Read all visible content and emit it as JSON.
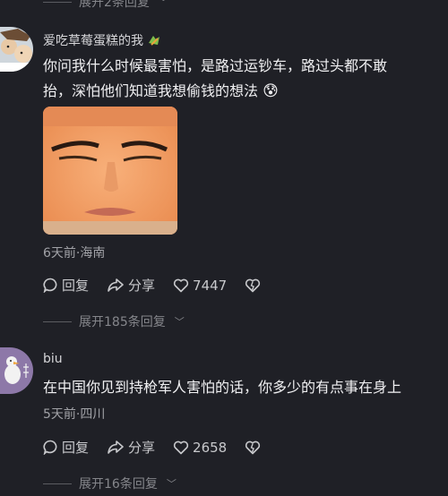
{
  "top_expand": {
    "label": "展开2条回复"
  },
  "comments": [
    {
      "username": "爱吃草莓蛋糕的我",
      "content_line1": "你问我什么时候最害怕，是路过运钞车，路过头都不敢",
      "content_line2": "抬，深怕他们知道我想偷钱的想法",
      "emoji": "😰",
      "meta": "6天前·海南",
      "reply_label": "回复",
      "share_label": "分享",
      "likes": "7447",
      "expand_label": "展开185条回复"
    },
    {
      "username": "biu",
      "content_line1": "在中国你见到持枪军人害怕的话，你多少的有点事在身上",
      "meta": "5天前·四川",
      "reply_label": "回复",
      "share_label": "分享",
      "likes": "2658",
      "expand_label": "展开16条回复"
    }
  ],
  "colors": {
    "background": "#1f2026",
    "text": "#f0f0f2",
    "muted": "#85868b"
  }
}
